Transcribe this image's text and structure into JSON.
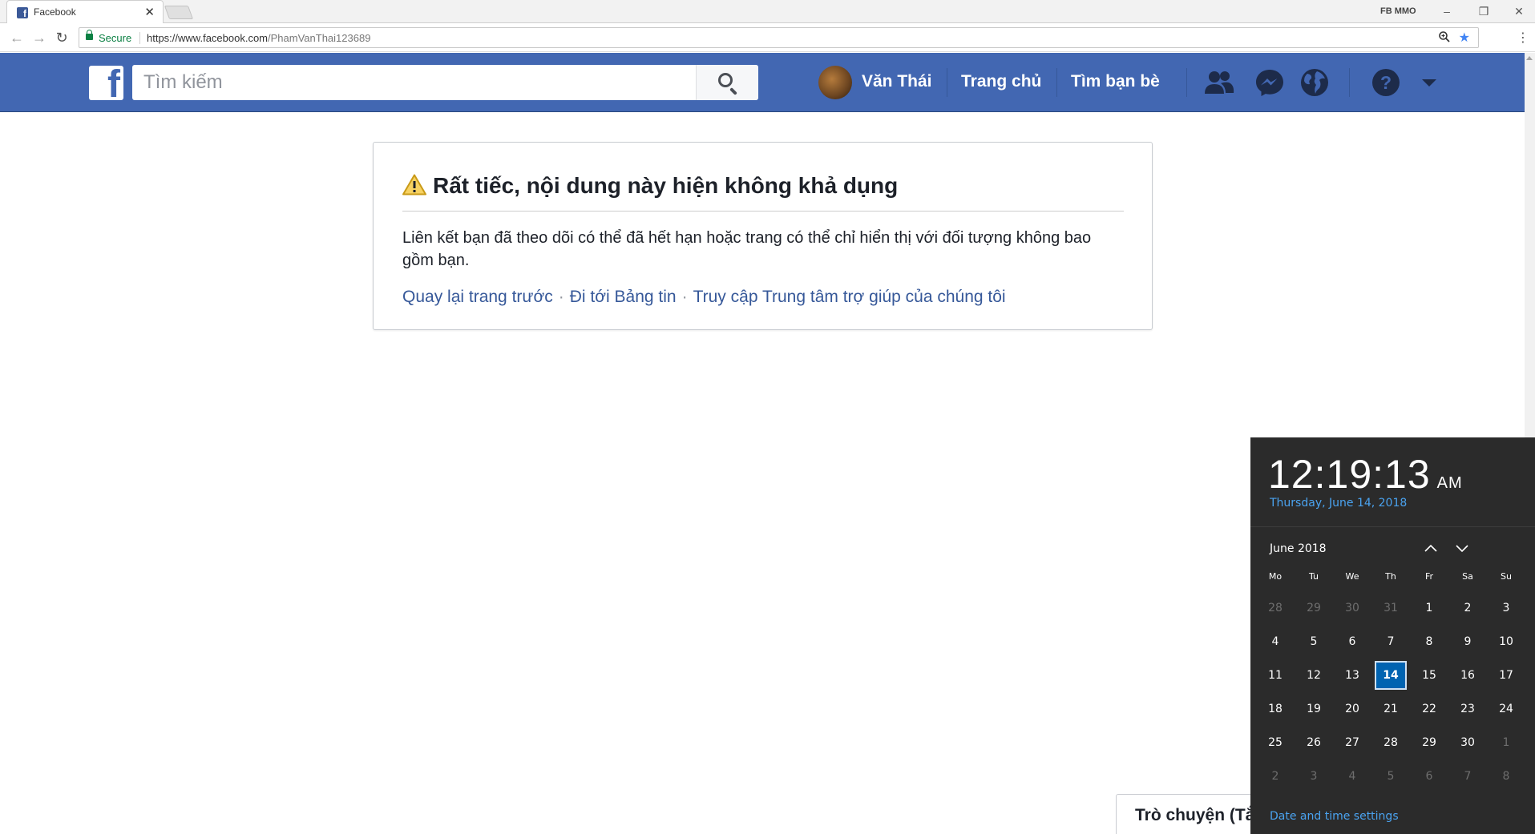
{
  "browser": {
    "tab_title": "Facebook",
    "tab_close": "✕",
    "profile_label": "FB MMO",
    "secure_label": "Secure",
    "url_host": "https://www.facebook.com",
    "url_path": "/PhamVanThai123689"
  },
  "fb": {
    "search_placeholder": "Tìm kiếm",
    "user_name": "Văn Thái",
    "nav": [
      "Trang chủ",
      "Tìm bạn bè"
    ],
    "icons": [
      "friend-requests-icon",
      "messenger-icon",
      "notifications-globe-icon",
      "help-icon",
      "dropdown-caret-icon"
    ],
    "brand_color": "#4267b2"
  },
  "error": {
    "title": "Rất tiếc, nội dung này hiện không khả dụng",
    "body": "Liên kết bạn đã theo dõi có thể đã hết hạn hoặc trang có thể chỉ hiển thị với đối tượng không bao gồm bạn.",
    "links": [
      "Quay lại trang trước",
      "Đi tới Bảng tin",
      "Truy cập Trung tâm trợ giúp của chúng tôi"
    ],
    "separator": "·"
  },
  "chat": {
    "label": "Trò chuyện (Tắt)"
  },
  "clock": {
    "time": "12:19:13",
    "ampm": "AM",
    "date": "Thursday, June 14, 2018",
    "month": "June 2018",
    "weekdays": [
      "Mo",
      "Tu",
      "We",
      "Th",
      "Fr",
      "Sa",
      "Su"
    ],
    "weeks": [
      [
        "28",
        "29",
        "30",
        "31",
        "1",
        "2",
        "3"
      ],
      [
        "4",
        "5",
        "6",
        "7",
        "8",
        "9",
        "10"
      ],
      [
        "11",
        "12",
        "13",
        "14",
        "15",
        "16",
        "17"
      ],
      [
        "18",
        "19",
        "20",
        "21",
        "22",
        "23",
        "24"
      ],
      [
        "25",
        "26",
        "27",
        "28",
        "29",
        "30",
        "1"
      ],
      [
        "2",
        "3",
        "4",
        "5",
        "6",
        "7",
        "8"
      ]
    ],
    "today": "14",
    "settings_link": "Date and time settings",
    "accent_color": "#0063b1"
  }
}
